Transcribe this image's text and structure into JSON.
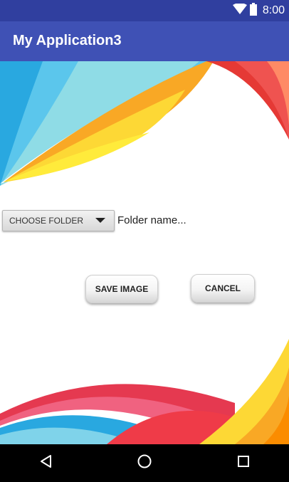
{
  "status_bar": {
    "time": "8:00",
    "icons": [
      "wifi-icon",
      "battery-icon"
    ]
  },
  "app_bar": {
    "title": "My Application3",
    "color": "#3f51b5",
    "status_color": "#303f9f"
  },
  "form": {
    "folder_spinner_label": "CHOOSE FOLDER",
    "folder_name_hint": "Folder name...",
    "save_label": "SAVE IMAGE",
    "cancel_label": "CANCEL"
  },
  "nav_bar": {
    "buttons": [
      "back-icon",
      "home-icon",
      "recents-icon"
    ]
  }
}
